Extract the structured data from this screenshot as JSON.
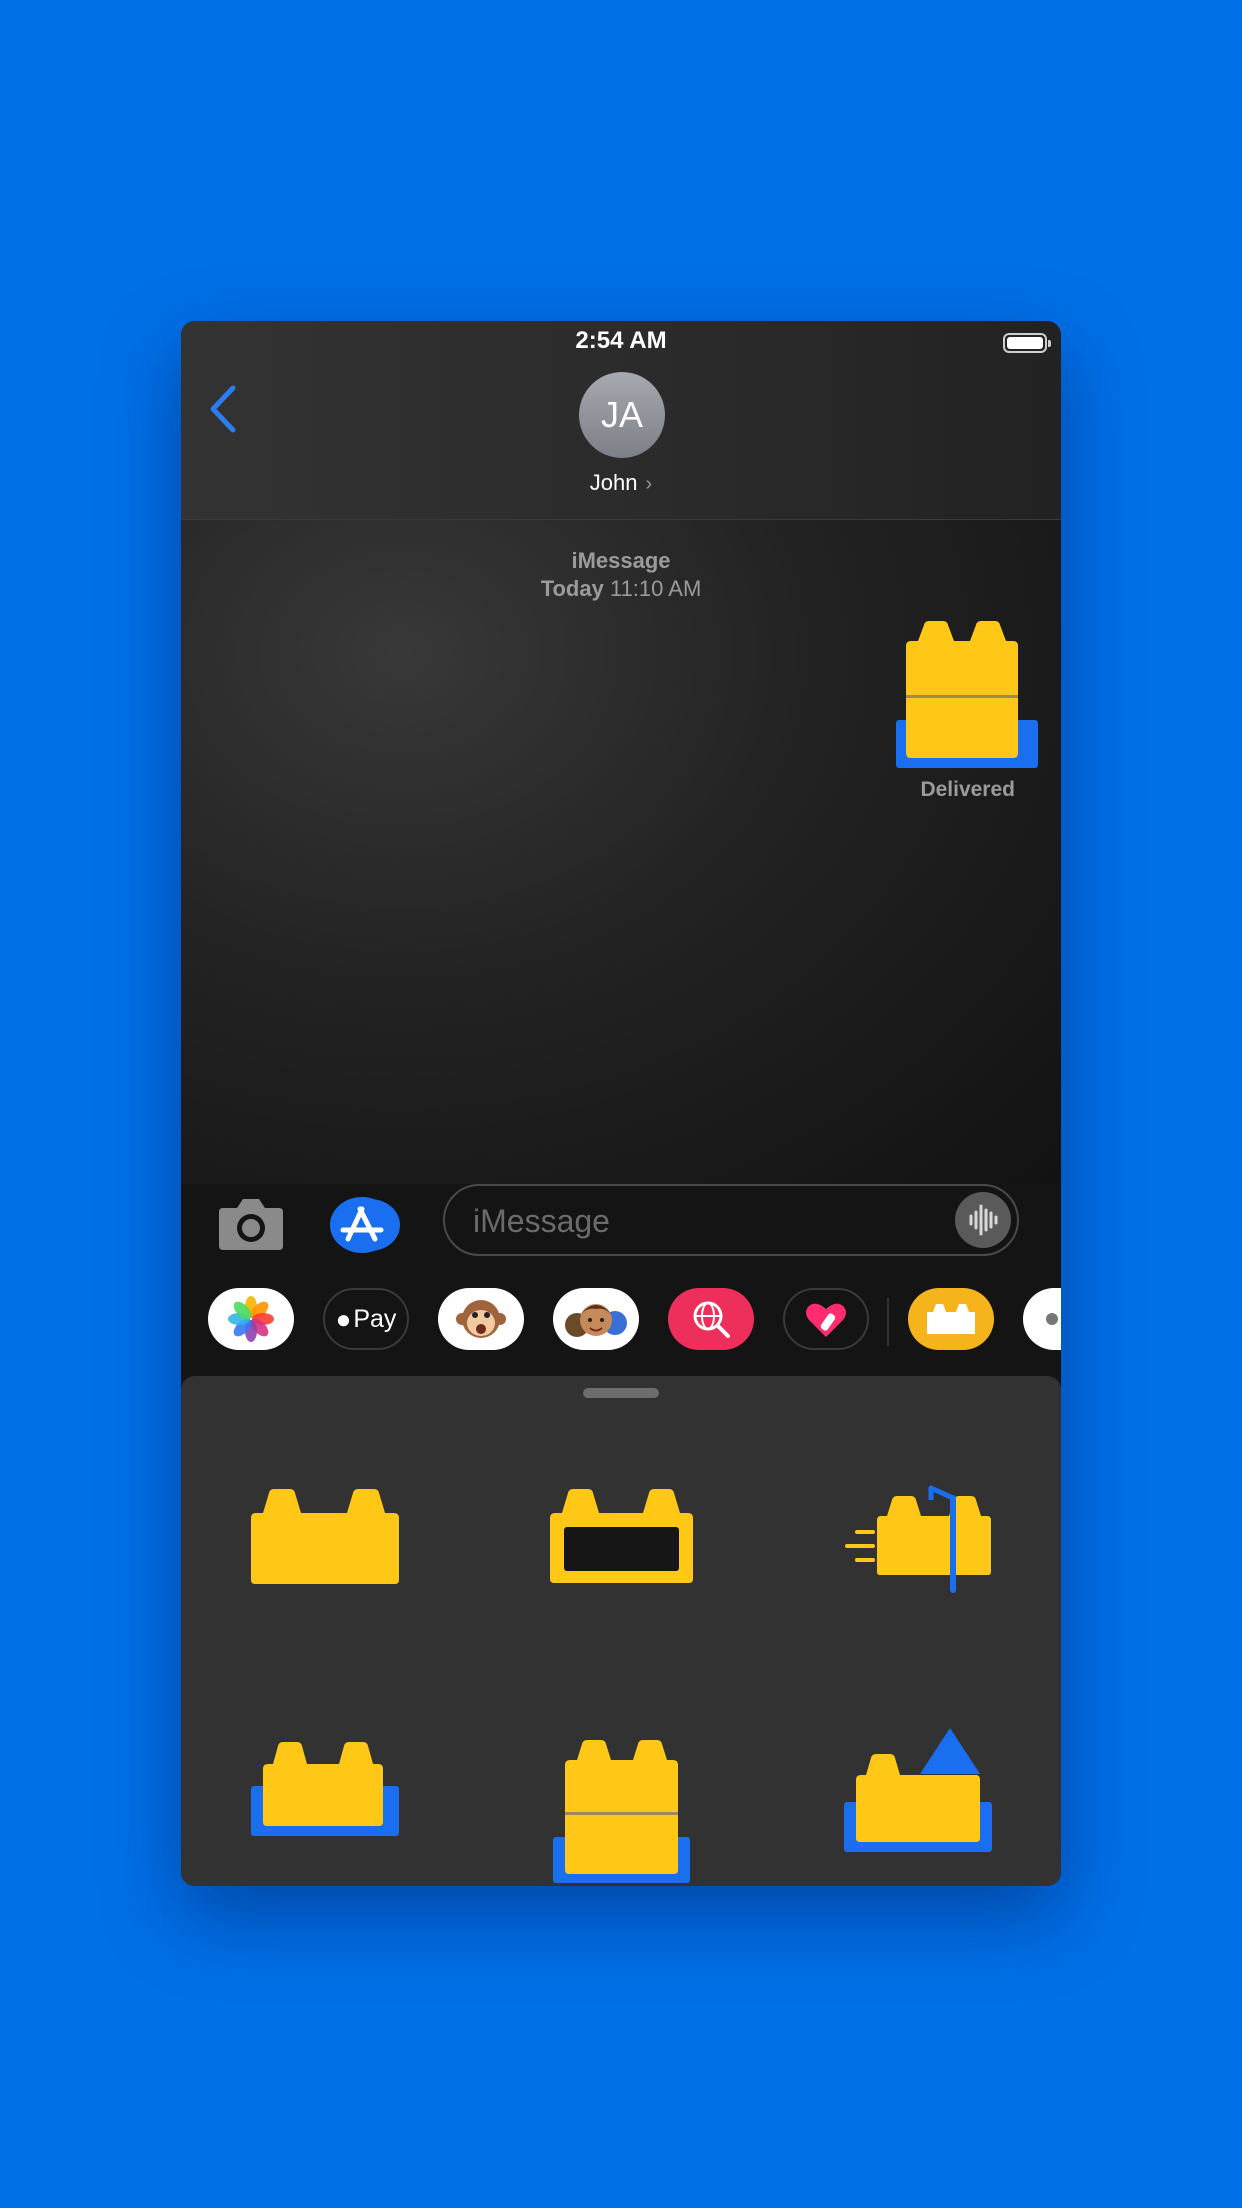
{
  "status_bar": {
    "time": "2:54 AM"
  },
  "header": {
    "avatar_initials": "JA",
    "contact_name": "John",
    "back": "chevron-left-icon"
  },
  "conversation": {
    "service": "iMessage",
    "timestamp_day": "Today",
    "timestamp_time": "11:10 AM",
    "message_status": "Delivered"
  },
  "compose": {
    "placeholder": "iMessage",
    "value": ""
  },
  "app_drawer": {
    "apps": [
      "Photos",
      "Apple Pay",
      "Animoji",
      "Memoji Stickers",
      "Images Search",
      "Digital Touch",
      "Brick Stickers",
      "More"
    ],
    "apple_pay_label": "Pay"
  },
  "sticker_panel": {
    "stickers": [
      "brick",
      "brick-with-window",
      "brick-with-flag",
      "brick-in-tray",
      "brick-tall-in-tray",
      "brick-with-triangle-in-tray"
    ]
  },
  "colors": {
    "background": "#0070E8",
    "accent": "#1A6FF0",
    "sticker_yellow": "#FFC817"
  }
}
